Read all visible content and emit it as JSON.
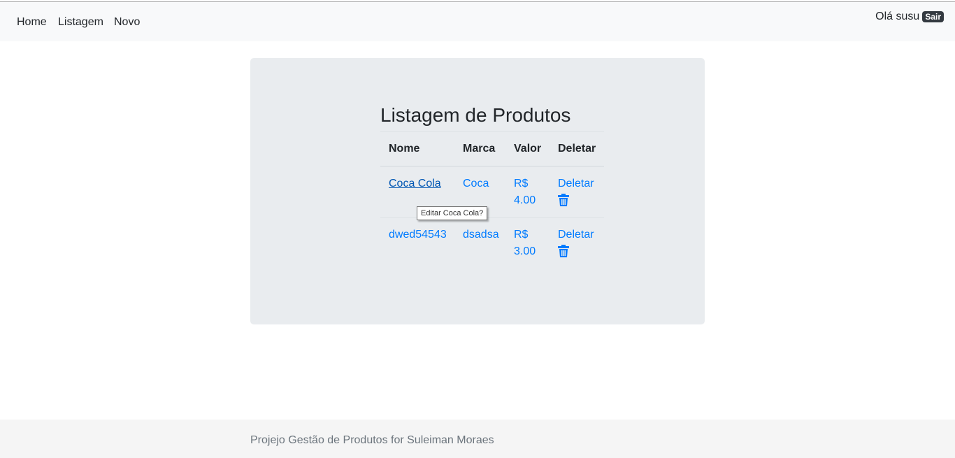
{
  "navbar": {
    "links": [
      "Home",
      "Listagem",
      "Novo"
    ],
    "greeting": "Olá susu",
    "logout_label": "Sair"
  },
  "main": {
    "title": "Listagem de Produtos",
    "table": {
      "headers": [
        "Nome",
        "Marca",
        "Valor",
        "Deletar"
      ],
      "rows": [
        {
          "nome": "Coca Cola",
          "marca": "Coca",
          "valor_currency": "R$",
          "valor_amount": "4.00",
          "delete_label": "Deletar"
        },
        {
          "nome": "dwed54543",
          "marca": "dsadsa",
          "valor_currency": "R$",
          "valor_amount": "3.00",
          "delete_label": "Deletar"
        }
      ]
    },
    "tooltip": "Editar Coca Cola?"
  },
  "footer": {
    "text": "Projejo Gestão de Produtos for Suleiman Moraes"
  },
  "colors": {
    "link": "#007bff",
    "link_hover": "#0056b3",
    "panel_bg": "#e9ecef",
    "navbar_bg": "#f8f9fa",
    "footer_bg": "#f5f5f5"
  },
  "icons": {
    "delete": "trash-icon"
  }
}
